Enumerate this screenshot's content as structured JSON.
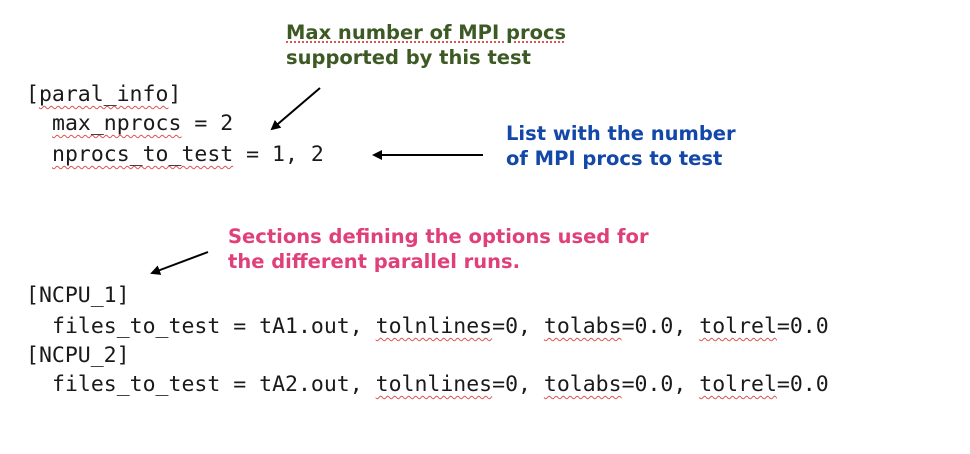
{
  "annotations": {
    "max_procs": {
      "line1": "Max number of MPI procs",
      "line2": "supported by this test",
      "color": "#3d5a24"
    },
    "nprocs_list": {
      "line1": "List with the number",
      "line2": "of MPI procs to test",
      "color": "#1347a8"
    },
    "sections": {
      "line1": "Sections defining the options used for",
      "line2": "the different parallel runs.",
      "color": "#e0407a"
    }
  },
  "code": {
    "paral_header": {
      "open": "[",
      "name": "paral_info",
      "close": "]"
    },
    "max_nprocs": {
      "key": "max_nprocs",
      "rest": " = 2"
    },
    "nprocs_to_test": {
      "key": "nprocs_to_test",
      "rest": " = 1, 2"
    },
    "sections": [
      {
        "header": "[NCPU_1]",
        "key": "files_to_test",
        "eq": " = ",
        "file": "tA1.out, ",
        "opt1": "tolnlines",
        "val1": "=0, ",
        "opt2": "tolabs",
        "val2": "=0.0, ",
        "opt3": "tolrel",
        "val3": "=0.0"
      },
      {
        "header": "[NCPU_2]",
        "key": "files_to_test",
        "eq": " = ",
        "file": "tA2.out, ",
        "opt1": "tolnlines",
        "val1": "=0, ",
        "opt2": "tolabs",
        "val2": "=0.0, ",
        "opt3": "tolrel",
        "val3": "=0.0"
      }
    ]
  }
}
